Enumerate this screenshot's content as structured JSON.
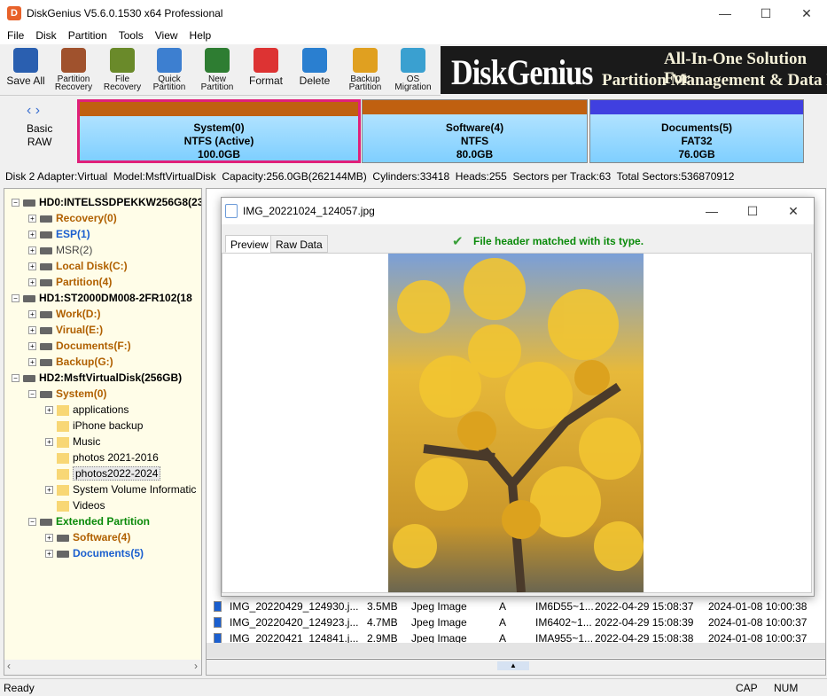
{
  "window": {
    "title": "DiskGenius V5.6.0.1530 x64 Professional",
    "logo": "D"
  },
  "menu": [
    "File",
    "Disk",
    "Partition",
    "Tools",
    "View",
    "Help"
  ],
  "toolbar": [
    {
      "label": "Save All",
      "icon": "save-icon"
    },
    {
      "label": "Partition Recovery",
      "icon": "magnifier-icon"
    },
    {
      "label": "File Recovery",
      "icon": "file-recovery-icon"
    },
    {
      "label": "Quick Partition",
      "icon": "quick-partition-icon"
    },
    {
      "label": "New Partition",
      "icon": "layers-icon"
    },
    {
      "label": "Format",
      "icon": "lifebuoy-icon"
    },
    {
      "label": "Delete",
      "icon": "trash-icon"
    },
    {
      "label": "Backup Partition",
      "icon": "pie-icon"
    },
    {
      "label": "OS Migration",
      "icon": "monitor-icon"
    }
  ],
  "banner": {
    "brand": "DiskGenius",
    "line1": "All-In-One Solution For",
    "line2": "Partition Management & Data Re"
  },
  "disk_nav": {
    "type": "Basic",
    "fs": "RAW"
  },
  "partitions": [
    {
      "name": "System(0)",
      "fs": "NTFS (Active)",
      "size": "100.0GB",
      "color": "#c06010"
    },
    {
      "name": "Software(4)",
      "fs": "NTFS",
      "size": "80.0GB",
      "color": "#c06010"
    },
    {
      "name": "Documents(5)",
      "fs": "FAT32",
      "size": "76.0GB",
      "color": "#4040e0"
    }
  ],
  "disk_info": "Disk 2 Adapter:Virtual  Model:MsftVirtualDisk  Capacity:256.0GB(262144MB)  Cylinders:33418  Heads:255  Sectors per Track:63  Total Sectors:536870912",
  "tree": [
    {
      "label": "HD0:INTELSSDPEKKW256G8(23",
      "cls": "k",
      "lvl": 0,
      "kind": "disk",
      "pm": "-"
    },
    {
      "label": "Recovery(0)",
      "cls": "o",
      "lvl": 1,
      "kind": "part",
      "pm": "+"
    },
    {
      "label": "ESP(1)",
      "cls": "b",
      "lvl": 1,
      "kind": "part",
      "pm": "+"
    },
    {
      "label": "MSR(2)",
      "cls": "gr",
      "lvl": 1,
      "kind": "part",
      "pm": "+"
    },
    {
      "label": "Local Disk(C:)",
      "cls": "o",
      "lvl": 1,
      "kind": "part",
      "pm": "+"
    },
    {
      "label": "Partition(4)",
      "cls": "o",
      "lvl": 1,
      "kind": "part",
      "pm": "+"
    },
    {
      "label": "HD1:ST2000DM008-2FR102(18",
      "cls": "k",
      "lvl": 0,
      "kind": "disk",
      "pm": "-"
    },
    {
      "label": "Work(D:)",
      "cls": "o",
      "lvl": 1,
      "kind": "part",
      "pm": "+"
    },
    {
      "label": "Virual(E:)",
      "cls": "o",
      "lvl": 1,
      "kind": "part",
      "pm": "+"
    },
    {
      "label": "Documents(F:)",
      "cls": "o",
      "lvl": 1,
      "kind": "part",
      "pm": "+"
    },
    {
      "label": "Backup(G:)",
      "cls": "o",
      "lvl": 1,
      "kind": "part",
      "pm": "+"
    },
    {
      "label": "HD2:MsftVirtualDisk(256GB)",
      "cls": "k",
      "lvl": 0,
      "kind": "disk",
      "pm": "-"
    },
    {
      "label": "System(0)",
      "cls": "o",
      "lvl": 1,
      "kind": "part",
      "pm": "-"
    },
    {
      "label": "applications",
      "cls": "",
      "lvl": 2,
      "kind": "folder",
      "pm": "+"
    },
    {
      "label": "iPhone backup",
      "cls": "",
      "lvl": 2,
      "kind": "folder",
      "pm": ""
    },
    {
      "label": "Music",
      "cls": "",
      "lvl": 2,
      "kind": "folder",
      "pm": "+"
    },
    {
      "label": "photos 2021-2016",
      "cls": "",
      "lvl": 2,
      "kind": "folder",
      "pm": ""
    },
    {
      "label": "photos2022-2024",
      "cls": "",
      "lvl": 2,
      "kind": "folder",
      "pm": "",
      "selected": true
    },
    {
      "label": "System Volume Informatic",
      "cls": "",
      "lvl": 2,
      "kind": "folder",
      "pm": "+"
    },
    {
      "label": "Videos",
      "cls": "",
      "lvl": 2,
      "kind": "folder",
      "pm": ""
    },
    {
      "label": "Extended Partition",
      "cls": "g",
      "lvl": 1,
      "kind": "disk",
      "pm": "-"
    },
    {
      "label": "Software(4)",
      "cls": "o",
      "lvl": 2,
      "kind": "part",
      "pm": "+"
    },
    {
      "label": "Documents(5)",
      "cls": "b",
      "lvl": 2,
      "kind": "part",
      "pm": "+"
    }
  ],
  "files": [
    {
      "name": "IMG_20220429_124930.j...",
      "size": "3.5MB",
      "type": "Jpeg Image",
      "attr": "A",
      "short": "IM6D55~1...",
      "modified": "2022-04-29 15:08:37",
      "created": "2024-01-08 10:00:38"
    },
    {
      "name": "IMG_20220420_124923.j...",
      "size": "4.7MB",
      "type": "Jpeg Image",
      "attr": "A",
      "short": "IM6402~1...",
      "modified": "2022-04-29 15:08:39",
      "created": "2024-01-08 10:00:37"
    },
    {
      "name": "IMG_20220421_124841.j...",
      "size": "2.9MB",
      "type": "Jpeg Image",
      "attr": "A",
      "short": "IMA955~1...",
      "modified": "2022-04-29 15:08:38",
      "created": "2024-01-08 10:00:37"
    }
  ],
  "dialog": {
    "title": "IMG_20221024_124057.jpg",
    "tabs": [
      "Preview",
      "Raw Data"
    ],
    "message": "File header matched with its type.",
    "message_color": "#0a8a0a"
  },
  "status": {
    "text": "Ready",
    "cap": "CAP",
    "num": "NUM"
  }
}
